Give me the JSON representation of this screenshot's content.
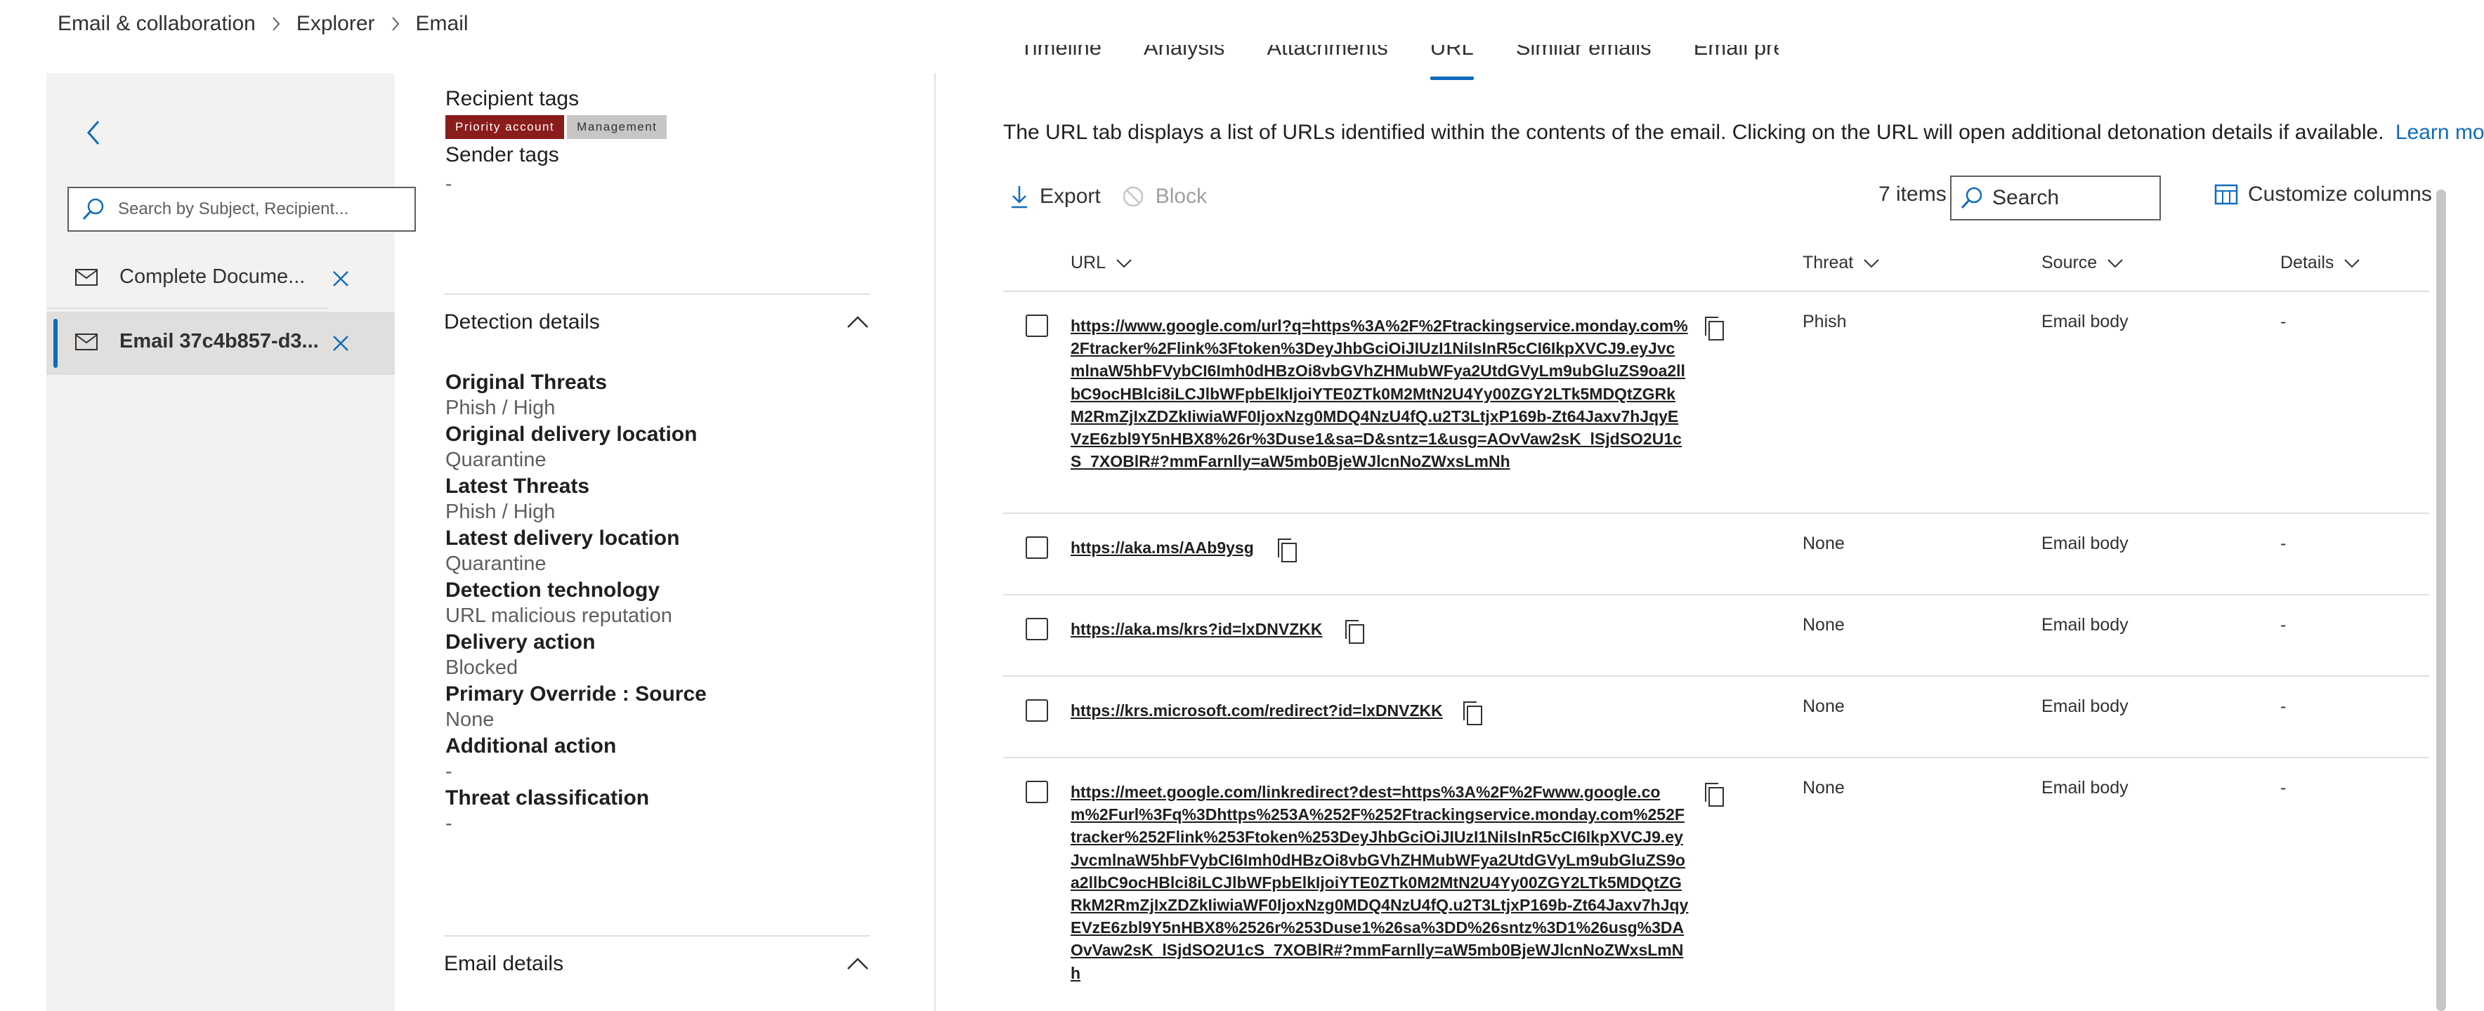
{
  "breadcrumb": [
    "Email & collaboration",
    "Explorer",
    "Email"
  ],
  "nav": {
    "search_placeholder": "Search by Subject, Recipient...",
    "items": [
      {
        "label": "Complete Docume..."
      },
      {
        "label": "Email 37c4b857-d3..."
      }
    ]
  },
  "details": {
    "recipient_tags_title": "Recipient tags",
    "tags": [
      "Priority account",
      "Management"
    ],
    "sender_tags_title": "Sender tags",
    "sender_tags_value": "-",
    "detection_section_title": "Detection details",
    "detection": [
      {
        "label": "Original Threats",
        "value": "Phish / High"
      },
      {
        "label": "Original delivery location",
        "value": "Quarantine"
      },
      {
        "label": "Latest Threats",
        "value": "Phish / High"
      },
      {
        "label": "Latest delivery location",
        "value": "Quarantine"
      },
      {
        "label": "Detection technology",
        "value": "URL malicious reputation"
      },
      {
        "label": "Delivery action",
        "value": "Blocked"
      },
      {
        "label": "Primary Override : Source",
        "value": "None"
      },
      {
        "label": "Additional action",
        "value": "-"
      },
      {
        "label": "Threat classification",
        "value": "-"
      }
    ],
    "email_section_title": "Email details"
  },
  "tabs": [
    "Timeline",
    "Analysis",
    "Attachments",
    "URL",
    "Similar emails",
    "Email preview"
  ],
  "active_tab": "URL",
  "url_tab": {
    "description": "The URL tab displays a list of URLs identified within the contents of the email. Clicking on the URL will open additional detonation details if available.",
    "learn_more": "Learn more",
    "export_label": "Export",
    "block_label": "Block",
    "items_count": "7 items",
    "search_placeholder": "Search",
    "customize_label": "Customize columns",
    "columns": {
      "url": "URL",
      "threat": "Threat",
      "source": "Source",
      "details": "Details"
    },
    "rows": [
      {
        "url": "https://www.google.com/url?q=https%3A%2F%2Ftrackingservice.monday.com%2Ftracker%2Flink%3Ftoken%3DeyJhbGciOiJIUzI1NiIsInR5cCI6IkpXVCJ9.eyJvcmlnaW5hbFVybCI6Imh0dHBzOi8vbGVhZHMubWFya2UtdGVyLm9ubGluZS9oa2llbC9ocHBlci8iLCJlbWFpbElkIjoiYTE0ZTk0M2MtN2U4Yy00ZGY2LTk5MDQtZGRkM2RmZjIxZDZkIiwiaWF0IjoxNzg0MDQ4NzU4fQ.u2T3LtjxP169b-Zt64Jaxv7hJqyEVzE6zbl9Y5nHBX8%26r%3Duse1&sa=D&sntz=1&usg=AOvVaw2sK_lSjdSO2U1cS_7XOBlR#?mmFarnlly=aW5mb0BjeWJlcnNoZWxsLmNh",
        "threat": "Phish",
        "source": "Email body",
        "details": "-"
      },
      {
        "url": "https://aka.ms/AAb9ysg",
        "threat": "None",
        "source": "Email body",
        "details": "-"
      },
      {
        "url": "https://aka.ms/krs?id=lxDNVZKK",
        "threat": "None",
        "source": "Email body",
        "details": "-"
      },
      {
        "url": "https://krs.microsoft.com/redirect?id=lxDNVZKK",
        "threat": "None",
        "source": "Email body",
        "details": "-"
      },
      {
        "url": "https://meet.google.com/linkredirect?dest=https%3A%2F%2Fwww.google.com%2Furl%3Fq%3Dhttps%253A%252F%252Ftrackingservice.monday.com%252Ftracker%252Flink%253Ftoken%253DeyJhbGciOiJIUzI1NiIsInR5cCI6IkpXVCJ9.eyJvcmlnaW5hbFVybCI6Imh0dHBzOi8vbGVhZHMubWFya2UtdGVyLm9ubGluZS9oa2llbC9ocHBlci8iLCJlbWFpbElkIjoiYTE0ZTk0M2MtN2U4Yy00ZGY2LTk5MDQtZGRkM2RmZjIxZDZkIiwiaWF0IjoxNzg0MDQ4NzU4fQ.u2T3LtjxP169b-Zt64Jaxv7hJqyEVzE6zbl9Y5nHBX8%2526r%253Duse1%26sa%3DD%26sntz%3D1%26usg%3DAOvVaw2sK_lSjdSO2U1cS_7XOBlR#?mmFarnlly=aW5mb0BjeWJlcnNoZWxsLmNh",
        "threat": "None",
        "source": "Email body",
        "details": "-"
      }
    ]
  },
  "colors": {
    "accent": "#0f6cbd",
    "priority_tag": "#8a1c1c",
    "management_tag": "#c8c6c4",
    "nav_bg": "#f3f2f1",
    "selected_nav": "#e1dfdd"
  },
  "icons": [
    "chevron-right-icon",
    "back-arrow-icon",
    "search-icon",
    "mail-icon",
    "close-icon",
    "chevron-up-icon",
    "download-icon",
    "block-icon",
    "customize-columns-icon",
    "chevron-down-icon",
    "copy-icon"
  ]
}
